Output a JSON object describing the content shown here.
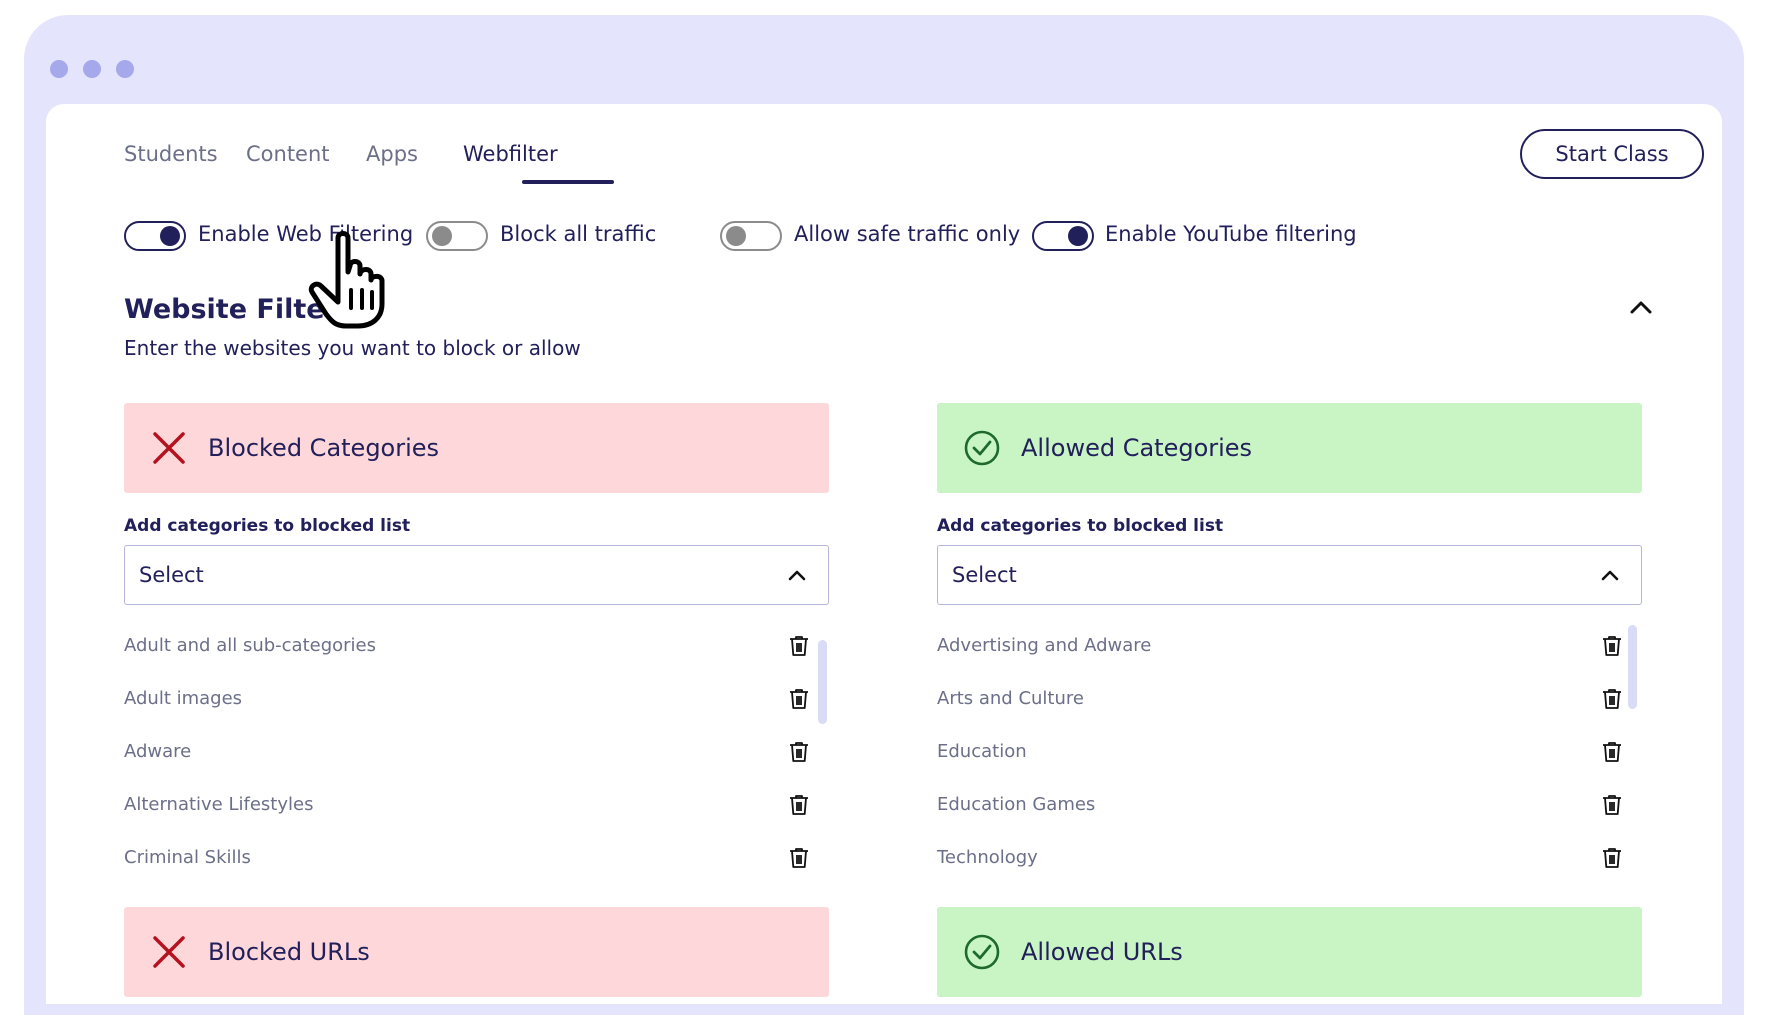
{
  "window": {
    "dots": [
      "dot",
      "dot",
      "dot"
    ]
  },
  "tabs": [
    {
      "label": "Students"
    },
    {
      "label": "Content"
    },
    {
      "label": "Apps"
    },
    {
      "label": "Webfilter",
      "active": true
    }
  ],
  "start_class_label": "Start Class",
  "toggles": [
    {
      "label": "Enable Web Filtering",
      "on": true
    },
    {
      "label": "Block all traffic",
      "on": false
    },
    {
      "label": "Allow safe traffic only",
      "on": false
    },
    {
      "label": "Enable YouTube filtering",
      "on": true
    }
  ],
  "website_filter": {
    "title": "Website Filter",
    "subtitle": "Enter the websites you want to block or allow"
  },
  "blocked_categories": {
    "title": "Blocked Categories",
    "field_label": "Add categories to blocked list",
    "select_value": "Select",
    "items": [
      "Adult and all sub-categories",
      "Adult images",
      "Adware",
      "Alternative Lifestyles",
      "Criminal Skills"
    ]
  },
  "allowed_categories": {
    "title": "Allowed Categories",
    "field_label": "Add categories to blocked list",
    "select_value": "Select",
    "items": [
      "Advertising and Adware",
      "Arts and Culture",
      "Education",
      "Education Games",
      "Technology"
    ]
  },
  "blocked_urls": {
    "title": "Blocked URLs"
  },
  "allowed_urls": {
    "title": "Allowed URLs"
  },
  "colors": {
    "navy": "#22205a",
    "blocked_bg": "#fdd7d9",
    "allowed_bg": "#c9f5c4",
    "blocked_icon": "#b3121e",
    "allowed_icon": "#1d6a2c",
    "window_bg": "#e4e5fc"
  }
}
